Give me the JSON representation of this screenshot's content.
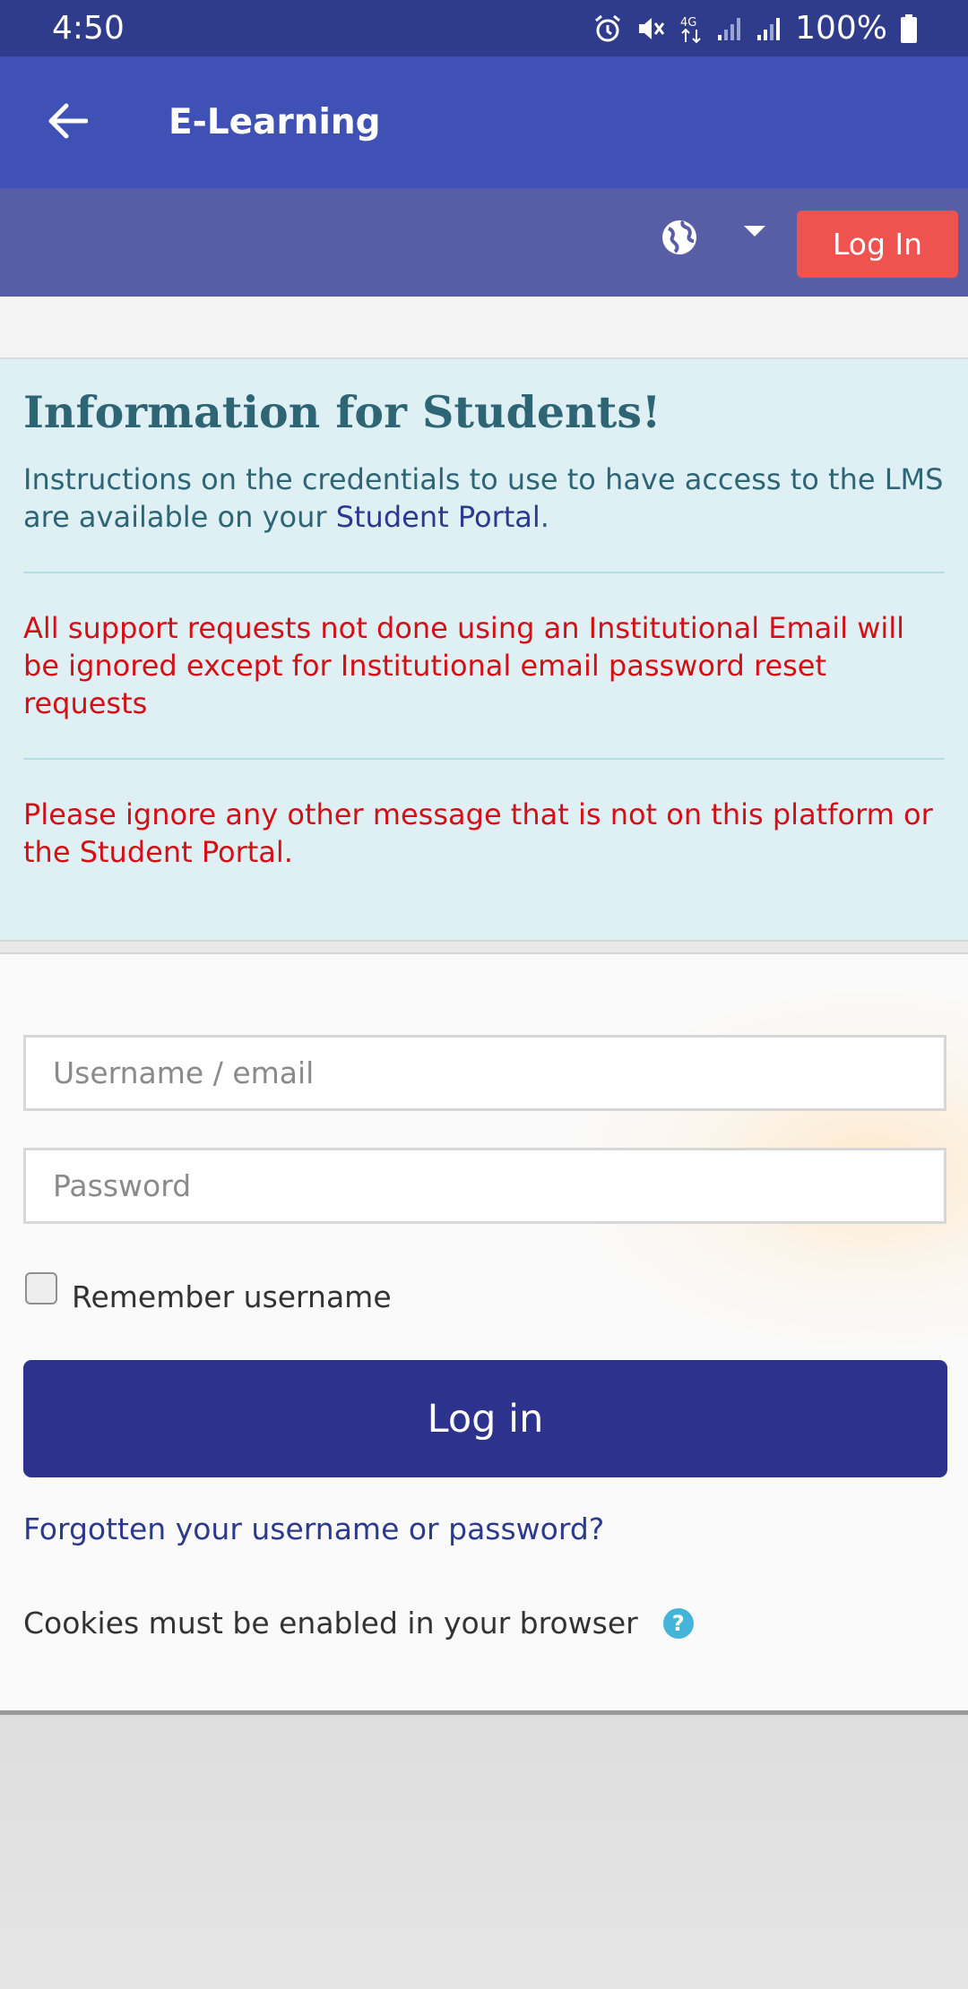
{
  "status_bar": {
    "time": "4:50",
    "battery": "100%",
    "icons": [
      "alarm-icon",
      "mute-icon",
      "4g-icon",
      "signal-icon",
      "signal-icon",
      "battery-icon"
    ]
  },
  "app_bar": {
    "back_icon": "arrow-left-icon",
    "title": "E-Learning"
  },
  "nav": {
    "language_icon": "globe-icon",
    "dropdown_icon": "caret-down-icon",
    "login_label": "Log In",
    "login_color": "#ef5350"
  },
  "info": {
    "title": "Information for Students!",
    "instructions_prefix": "Instructions on the credentials to use to have access to the LMS are available on your ",
    "instructions_link": "Student Portal",
    "instructions_suffix": ".",
    "warning_1": "All support requests not done using an Institutional Email will be ignored except for Institutional email password reset requests",
    "warning_2": "Please ignore any other message that is not on this platform or the Student Portal."
  },
  "form": {
    "username_placeholder": "Username / email",
    "password_placeholder": "Password",
    "remember_label": "Remember username",
    "remember_checked": false,
    "login_button": "Log in",
    "forgot_link": "Forgotten your username or password?",
    "cookies_text": "Cookies must be enabled in your browser",
    "help_icon": "question-circle-icon"
  },
  "colors": {
    "status_bar": "#2f3c8c",
    "app_bar": "#3f51b5",
    "nav_bar": "#585ea5",
    "info_bg": "#dff0f5",
    "warning_text": "#d40f16",
    "primary_button": "#2d338d"
  }
}
